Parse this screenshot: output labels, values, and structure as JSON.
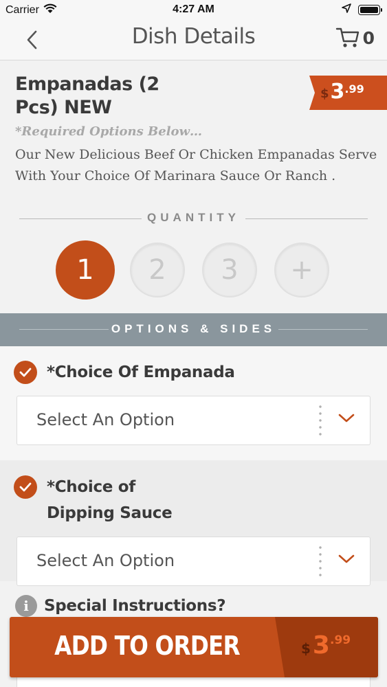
{
  "status_bar": {
    "carrier": "Carrier",
    "time": "4:27 AM"
  },
  "nav": {
    "title": "Dish Details",
    "cart_count": "0"
  },
  "dish": {
    "name": "Empanadas (2 Pcs) NEW",
    "price": {
      "symbol": "$",
      "dollars": "3",
      "cents": ".99"
    },
    "required_note": "*Required Options Below…",
    "description": "Our New Delicious Beef Or Chicken Empanadas Serve With Your Choice Of Marinara Sauce Or Ranch ."
  },
  "quantity": {
    "label": "QUANTITY",
    "options": [
      "1",
      "2",
      "3",
      "+"
    ],
    "selected": "1"
  },
  "options_header": "OPTIONS & SIDES",
  "options": [
    {
      "title": "*Choice Of Empanada",
      "placeholder": "Select An Option"
    },
    {
      "title_line1": "*Choice of",
      "title_line2": "Dipping Sauce",
      "placeholder": "Select An Option"
    }
  ],
  "special_instructions": {
    "label": "Special Instructions?"
  },
  "add_to_order": {
    "label": "ADD TO ORDER",
    "price": {
      "symbol": "$",
      "dollars": "3",
      "cents": ".99"
    }
  },
  "colors": {
    "accent": "#c24e1a",
    "accent_dark": "#9e3a0e",
    "options_bar": "#8a969d"
  },
  "icons": [
    "wifi-icon",
    "location-arrow-icon",
    "battery-icon",
    "back-chevron-icon",
    "cart-icon",
    "check-icon",
    "chevron-down-icon",
    "info-icon"
  ]
}
